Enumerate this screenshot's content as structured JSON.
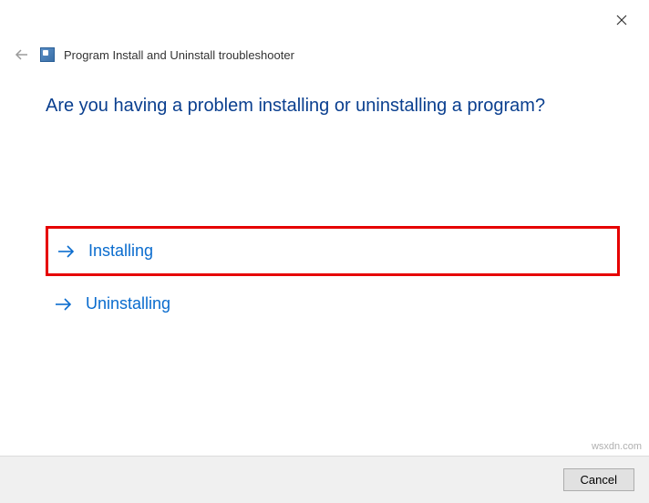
{
  "window": {
    "title": "Program Install and Uninstall troubleshooter"
  },
  "content": {
    "question": "Are you having a problem installing or uninstalling a program?",
    "options": [
      {
        "label": "Installing",
        "highlighted": true
      },
      {
        "label": "Uninstalling",
        "highlighted": false
      }
    ]
  },
  "footer": {
    "cancel_label": "Cancel"
  },
  "watermark": "wsxdn.com"
}
